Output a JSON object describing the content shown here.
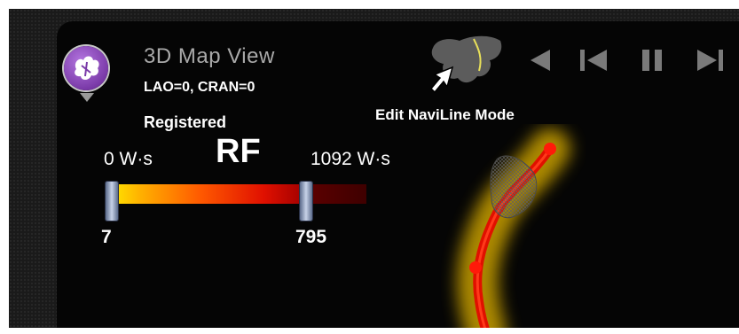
{
  "header": {
    "title": "3D Map View",
    "angles": "LAO=0, CRAN=0",
    "status": "Registered"
  },
  "rf_scale": {
    "min_label": "0 W·s",
    "label": "RF",
    "max_label": "1092 W·s",
    "low_value": "7",
    "high_value": "795"
  },
  "toolbar": {
    "edit_mode_label": "Edit NaviLine Mode"
  },
  "colors": {
    "title_gray": "#a9a9a9",
    "icon_purple": "#7a3aa8",
    "catheter_red": "#e01000",
    "glow_yellow": "#d4b000"
  },
  "icons": [
    "map-view-icon",
    "naviline-edit-icon",
    "cursor-arrow-icon",
    "step-back-icon",
    "skip-to-start-icon",
    "pause-icon",
    "skip-to-end-icon"
  ]
}
